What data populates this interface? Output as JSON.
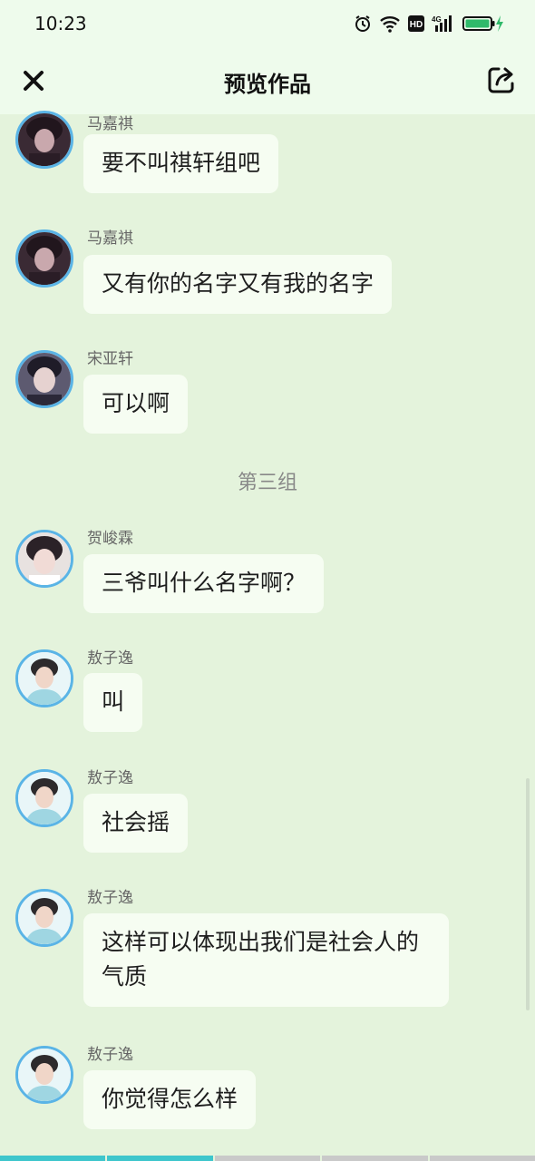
{
  "status_bar": {
    "time": "10:23",
    "network": "4G"
  },
  "header": {
    "title": "预览作品"
  },
  "messages": [
    {
      "name": "马嘉祺",
      "text": "要不叫祺轩组吧"
    },
    {
      "name": "马嘉祺",
      "text": "又有你的名字又有我的名字"
    },
    {
      "name": "宋亚轩",
      "text": "可以啊"
    },
    {
      "name": "贺峻霖",
      "text": "三爷叫什么名字啊？"
    },
    {
      "name": "敖子逸",
      "text": "叫"
    },
    {
      "name": "敖子逸",
      "text": "社会摇"
    },
    {
      "name": "敖子逸",
      "text": "这样可以体现出我们是社会人的气质"
    },
    {
      "name": "敖子逸",
      "text": "你觉得怎么样"
    }
  ],
  "section_label": "第三组",
  "progress": {
    "segments": 5,
    "active": 2
  },
  "colors": {
    "background": "#e4f3dc",
    "bubble": "#f6fdf2",
    "avatar_border": "#5ab4e6",
    "progress_active": "#3ec6cc"
  }
}
